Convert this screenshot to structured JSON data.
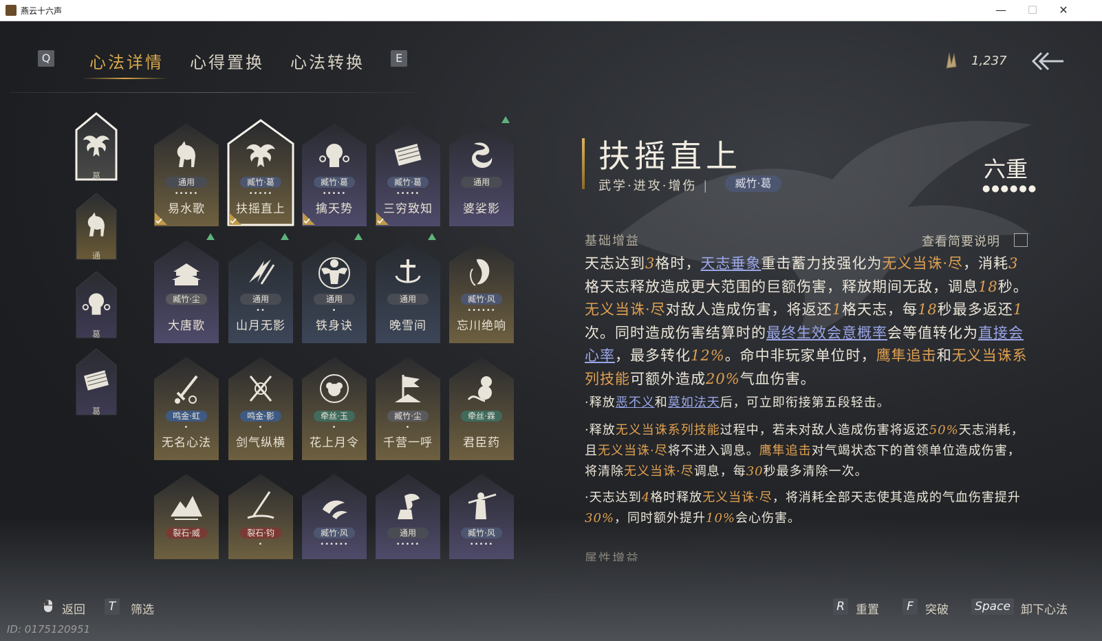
{
  "window": {
    "title": "燕云十六声",
    "controls": [
      "minimize-icon",
      "maximize-icon",
      "close-icon"
    ]
  },
  "tabs": {
    "key_left": "Q",
    "key_right": "E",
    "items": [
      {
        "label": "心法详情",
        "active": true
      },
      {
        "label": "心得置换",
        "active": false
      },
      {
        "label": "心法转换",
        "active": false
      }
    ]
  },
  "currency": {
    "icon": "feather-currency-icon",
    "value": "1,237"
  },
  "equipped": [
    {
      "icon": "eagle-icon",
      "label": "葛",
      "selected": true
    },
    {
      "icon": "horse-icon",
      "label": "通",
      "selected": false
    },
    {
      "icon": "chain-fist-icon",
      "label": "葛",
      "selected": false
    },
    {
      "icon": "scroll-icon",
      "label": "葛",
      "selected": false
    }
  ],
  "cards": [
    {
      "name": "易水歌",
      "tag": "通用",
      "tag_color": "#4a4c54",
      "dots": "•••••",
      "icon": "horse-icon",
      "style": "gold",
      "check": true,
      "up": false
    },
    {
      "name": "扶摇直上",
      "tag": "臧竹·葛",
      "tag_color": "#4d5670",
      "dots": "•••••",
      "icon": "eagle-icon",
      "style": "gold",
      "check": true,
      "up": false,
      "selected": true
    },
    {
      "name": "擒天势",
      "tag": "臧竹·葛",
      "tag_color": "#4d5670",
      "dots": "•••••",
      "icon": "chain-fist-icon",
      "style": "purple",
      "check": true,
      "up": false
    },
    {
      "name": "三穷致知",
      "tag": "臧竹·葛",
      "tag_color": "#4d5670",
      "dots": "•••••",
      "icon": "scroll-icon",
      "style": "purple",
      "check": true,
      "up": false
    },
    {
      "name": "婆娑影",
      "tag": "通用",
      "tag_color": "#4a4c54",
      "dots": "",
      "icon": "dragon-icon",
      "style": "purple",
      "check": false,
      "up": true
    },
    {
      "name": "大唐歌",
      "tag": "臧竹·尘",
      "tag_color": "#5a5a5e",
      "dots": "",
      "icon": "palace-icon",
      "style": "purple",
      "check": false,
      "up": true
    },
    {
      "name": "山月无影",
      "tag": "通用",
      "tag_color": "#4a4c54",
      "dots": "••",
      "icon": "claw-slash-icon",
      "style": "blue",
      "check": false,
      "up": true
    },
    {
      "name": "铁身诀",
      "tag": "通用",
      "tag_color": "#4a4c54",
      "dots": "•",
      "icon": "strongman-icon",
      "style": "blue",
      "check": false,
      "up": true
    },
    {
      "name": "晚雪间",
      "tag": "通用",
      "tag_color": "#4a4c54",
      "dots": "",
      "icon": "anchor-icon",
      "style": "blue",
      "check": false,
      "up": true
    },
    {
      "name": "忘川绝响",
      "tag": "臧竹·风",
      "tag_color": "#4d5670",
      "dots": "••••••",
      "icon": "ghost-face-icon",
      "style": "gold",
      "check": false,
      "up": false
    },
    {
      "name": "无名心法",
      "tag": "鸣金·虹",
      "tag_color": "#3e5a82",
      "dots": "•",
      "icon": "sword-icon",
      "style": "gold",
      "check": false,
      "up": false
    },
    {
      "name": "剑气纵横",
      "tag": "鸣金·影",
      "tag_color": "#3e5a82",
      "dots": "•",
      "icon": "crossed-swords-icon",
      "style": "gold",
      "check": false,
      "up": false
    },
    {
      "name": "花上月令",
      "tag": "牵丝·玉",
      "tag_color": "#3f6a5c",
      "dots": "•",
      "icon": "flower-moon-icon",
      "style": "gold",
      "check": false,
      "up": false
    },
    {
      "name": "千营一呼",
      "tag": "臧竹·尘",
      "tag_color": "#5a5a5e",
      "dots": "•",
      "icon": "banner-icon",
      "style": "gold",
      "check": false,
      "up": false
    },
    {
      "name": "君臣药",
      "tag": "牵丝·霖",
      "tag_color": "#3f6a5c",
      "dots": "",
      "icon": "gourd-icon",
      "style": "gold",
      "check": false,
      "up": false
    },
    {
      "name": "",
      "tag": "裂石·威",
      "tag_color": "#7a3a34",
      "dots": "",
      "icon": "mountain-icon",
      "style": "gold",
      "check": false,
      "up": false
    },
    {
      "name": "",
      "tag": "裂石·钧",
      "tag_color": "#7a3a34",
      "dots": "•",
      "icon": "spear-icon",
      "style": "gold",
      "check": false,
      "up": false
    },
    {
      "name": "",
      "tag": "臧竹·风",
      "tag_color": "#4d5670",
      "dots": "••••••",
      "icon": "fish-icon",
      "style": "purple",
      "check": false,
      "up": false
    },
    {
      "name": "",
      "tag": "通用",
      "tag_color": "#4a4c54",
      "dots": "•••••",
      "icon": "bird-hand-icon",
      "style": "purple",
      "check": false,
      "up": false
    },
    {
      "name": "",
      "tag": "臧竹·风",
      "tag_color": "#4d5670",
      "dots": "•••••",
      "icon": "swordsman-icon",
      "style": "purple",
      "check": false,
      "up": false
    }
  ],
  "detail": {
    "title": "扶摇直上",
    "subtitle": "武学·进攻·增伤",
    "tag": "臧竹·葛",
    "rank": "六重",
    "rank_dots": "●●●●●●",
    "section_basic": "基础增益",
    "view_note": "查看简要说明",
    "section_attr": "属性增益",
    "main_paragraph": [
      [
        "t",
        "天志达到"
      ],
      [
        "n",
        "3"
      ],
      [
        "t",
        "格时，"
      ],
      [
        "b",
        "天志垂象"
      ],
      [
        "t",
        "重击蓄力技强化为"
      ],
      [
        "o",
        "无义当诛·尽"
      ],
      [
        "t",
        "，消耗"
      ],
      [
        "n",
        "3"
      ],
      [
        "t",
        "格天志释放造成更大范围的巨额伤害，释放期间无敌，调息"
      ],
      [
        "n",
        "18"
      ],
      [
        "t",
        "秒。"
      ],
      [
        "o",
        "无义当诛·尽"
      ],
      [
        "t",
        "对敌人造成伤害，将返还"
      ],
      [
        "n",
        "1"
      ],
      [
        "t",
        "格天志，每"
      ],
      [
        "n",
        "18"
      ],
      [
        "t",
        "秒最多返还"
      ],
      [
        "n",
        "1"
      ],
      [
        "t",
        "次。同时造成伤害结算时的"
      ],
      [
        "b",
        "最终生效会意概率"
      ],
      [
        "t",
        "会等值转化为"
      ],
      [
        "b",
        "直接会心率"
      ],
      [
        "t",
        "，最多转化"
      ],
      [
        "n",
        "12%"
      ],
      [
        "t",
        "。命中非玩家单位时，"
      ],
      [
        "o",
        "鹰隼追击"
      ],
      [
        "t",
        "和"
      ],
      [
        "o",
        "无义当诛系列技能"
      ],
      [
        "t",
        "可额外造成"
      ],
      [
        "n",
        "20%"
      ],
      [
        "t",
        "气血伤害。"
      ]
    ],
    "bullets": [
      [
        [
          "t",
          "·释放"
        ],
        [
          "b",
          "恶不义"
        ],
        [
          "t",
          "和"
        ],
        [
          "b",
          "莫如法天"
        ],
        [
          "t",
          "后，可立即衔接第五段轻击。"
        ]
      ],
      [
        [
          "t",
          "·释放"
        ],
        [
          "o",
          "无义当诛系列技能"
        ],
        [
          "t",
          "过程中，若未对敌人造成伤害将返还"
        ],
        [
          "n",
          "50%"
        ],
        [
          "t",
          "天志消耗，且"
        ],
        [
          "o",
          "无义当诛·尽"
        ],
        [
          "t",
          "将不进入调息。"
        ],
        [
          "o",
          "鹰隼追击"
        ],
        [
          "t",
          "对气竭状态下的首领单位造成伤害，将清除"
        ],
        [
          "o",
          "无义当诛·尽"
        ],
        [
          "t",
          "调息，每"
        ],
        [
          "n",
          "30"
        ],
        [
          "t",
          "秒最多清除一次。"
        ]
      ],
      [
        [
          "t",
          "·天志达到"
        ],
        [
          "n",
          "4"
        ],
        [
          "t",
          "格时释放"
        ],
        [
          "o",
          "无义当诛·尽"
        ],
        [
          "t",
          "，将消耗全部天志使其造成的气血伤害提升"
        ],
        [
          "n",
          "30%"
        ],
        [
          "t",
          "，同时额外提升"
        ],
        [
          "n",
          "10%"
        ],
        [
          "t",
          "会心伤害。"
        ]
      ]
    ]
  },
  "bottom_bar": {
    "back": {
      "icon": "mouse-icon",
      "label": "返回"
    },
    "filter": {
      "key": "T",
      "label": "筛选"
    },
    "reset": {
      "key": "R",
      "label": "重置"
    },
    "breakthrough": {
      "key": "F",
      "label": "突破"
    },
    "unequip": {
      "key": "Space",
      "label": "卸下心法"
    }
  },
  "uid": "ID: 0175120951"
}
